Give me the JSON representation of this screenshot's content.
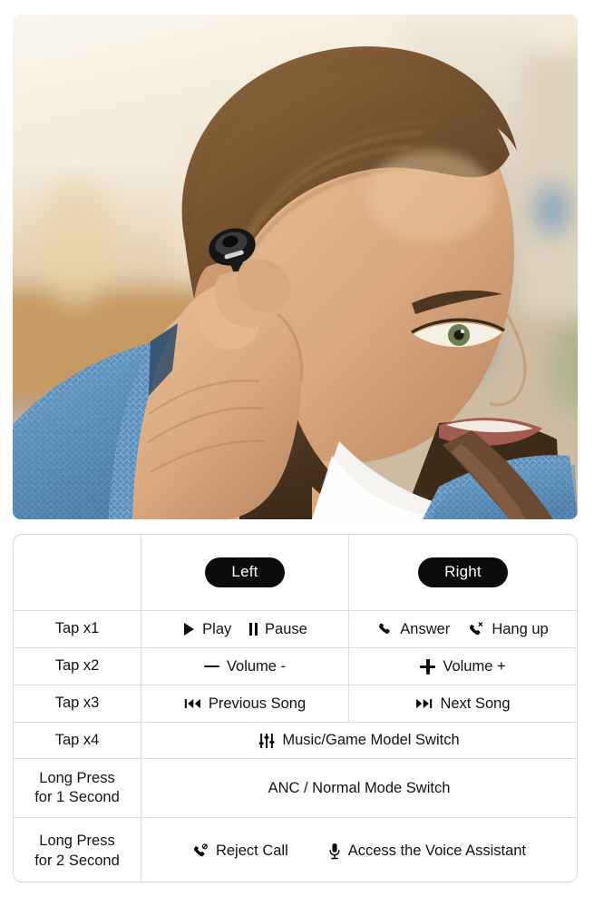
{
  "hero": {
    "alt": "Man with beard wearing a black wireless earbud, touching the earbud with his hand, blurred warm street background",
    "subject": "bearded-man-wearing-earbud",
    "colors": {
      "background_sky": "#f3ece0",
      "background_warm": "#d8b484",
      "skin": "#d9a87f",
      "hair": "#6b4b2c",
      "beard": "#4a3320",
      "blazer": "#5b8ebb",
      "shirt": "#f4f3ef",
      "strap": "#6b4a33",
      "earbud": "#151515"
    }
  },
  "table": {
    "header": {
      "label": "",
      "left_label": "Left",
      "right_label": "Right"
    },
    "rows": [
      {
        "label": "Tap x1",
        "span": false,
        "left": [
          {
            "icon": "play-icon",
            "text": "Play"
          },
          {
            "icon": "pause-icon",
            "text": "Pause"
          }
        ],
        "right": [
          {
            "icon": "phone-answer-icon",
            "text": "Answer"
          },
          {
            "icon": "phone-hangup-icon",
            "text": "Hang up"
          }
        ]
      },
      {
        "label": "Tap x2",
        "span": false,
        "left": [
          {
            "icon": "minus-icon",
            "text": "Volume -"
          }
        ],
        "right": [
          {
            "icon": "plus-icon",
            "text": "Volume +"
          }
        ]
      },
      {
        "label": "Tap x3",
        "span": false,
        "left": [
          {
            "icon": "previous-track-icon",
            "text": "Previous Song"
          }
        ],
        "right": [
          {
            "icon": "next-track-icon",
            "text": "Next Song"
          }
        ]
      },
      {
        "label": "Tap x4",
        "span": true,
        "items": [
          {
            "icon": "equalizer-icon",
            "text": "Music/Game Model Switch"
          }
        ]
      },
      {
        "label": "Long Press\nfor 1 Second",
        "label_line1": "Long Press",
        "label_line2": "for 1 Second",
        "span": true,
        "items": [
          {
            "icon": "",
            "text": "ANC / Normal Mode Switch"
          }
        ]
      },
      {
        "label": "Long Press\nfor 2 Second",
        "label_line1": "Long Press",
        "label_line2": "for 2 Second",
        "span": true,
        "items": [
          {
            "icon": "phone-reject-icon",
            "text": "Reject Call"
          },
          {
            "icon": "microphone-icon",
            "text": "Access the Voice Assistant"
          }
        ]
      }
    ]
  },
  "colors": {
    "pill_background": "#0b0b0b",
    "pill_text": "#ffffff",
    "table_border": "#dcdcdc",
    "text": "#121212",
    "page_background": "#ffffff"
  }
}
